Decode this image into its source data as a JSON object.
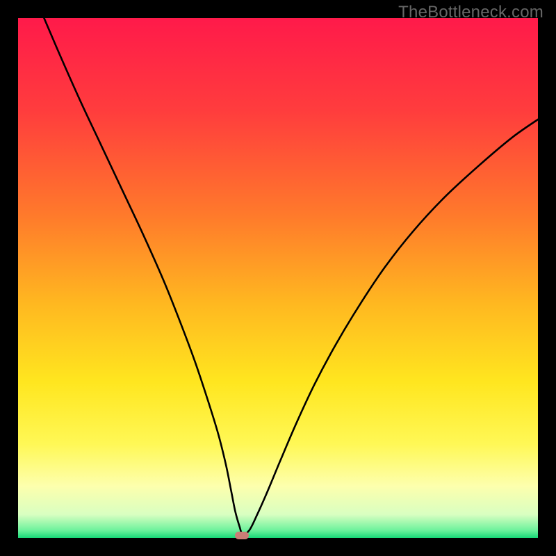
{
  "watermark": "TheBottleneck.com",
  "colors": {
    "frame": "#000000",
    "curve": "#000000",
    "marker": "#cb7d76",
    "gradient_stops": [
      {
        "offset": 0.0,
        "color": "#ff1a4a"
      },
      {
        "offset": 0.18,
        "color": "#ff3d3d"
      },
      {
        "offset": 0.38,
        "color": "#ff7a2b"
      },
      {
        "offset": 0.55,
        "color": "#ffb820"
      },
      {
        "offset": 0.7,
        "color": "#ffe61f"
      },
      {
        "offset": 0.82,
        "color": "#fff856"
      },
      {
        "offset": 0.9,
        "color": "#fdffad"
      },
      {
        "offset": 0.955,
        "color": "#d9ffc1"
      },
      {
        "offset": 0.985,
        "color": "#6ef29d"
      },
      {
        "offset": 1.0,
        "color": "#17d877"
      }
    ]
  },
  "chart_data": {
    "type": "line",
    "title": "",
    "xlabel": "",
    "ylabel": "",
    "xlim": [
      0,
      100
    ],
    "ylim": [
      0,
      100
    ],
    "grid": false,
    "legend": false,
    "series": [
      {
        "name": "bottleneck-curve",
        "x": [
          5,
          8,
          12,
          16,
          20,
          24,
          28,
          31,
          34,
          36.5,
          38.5,
          40,
          41,
          41.8,
          42.6,
          43.2,
          44.5,
          46,
          48,
          50.5,
          53.5,
          57,
          61,
          65.5,
          70.5,
          76,
          82,
          88.5,
          95,
          100
        ],
        "y": [
          100,
          93,
          84,
          75.5,
          67,
          58.5,
          49.5,
          42,
          34,
          26.5,
          20,
          14,
          9,
          5,
          2.2,
          0.7,
          1.5,
          4.5,
          9,
          15,
          22,
          29.5,
          37,
          44.5,
          52,
          59,
          65.5,
          71.5,
          77,
          80.5
        ]
      }
    ],
    "annotations": [
      {
        "name": "minimum-marker",
        "x": 43.0,
        "y": 0.5
      }
    ]
  }
}
